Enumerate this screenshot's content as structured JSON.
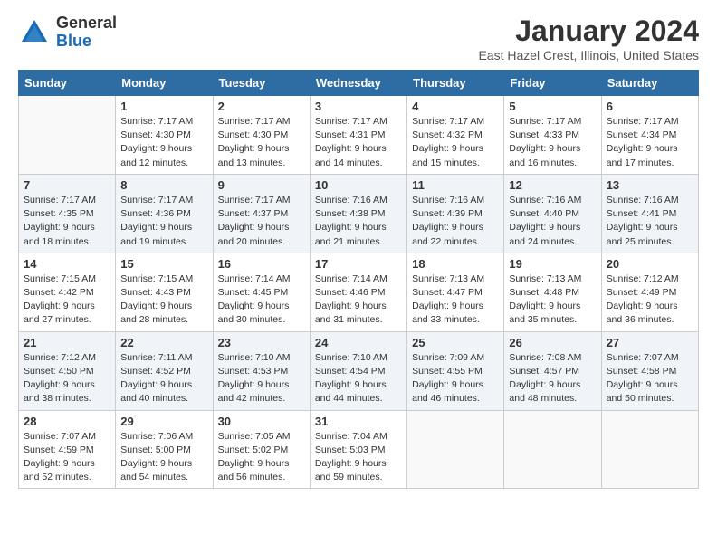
{
  "logo": {
    "general": "General",
    "blue": "Blue"
  },
  "title": "January 2024",
  "subtitle": "East Hazel Crest, Illinois, United States",
  "headers": [
    "Sunday",
    "Monday",
    "Tuesday",
    "Wednesday",
    "Thursday",
    "Friday",
    "Saturday"
  ],
  "weeks": [
    [
      {
        "day": "",
        "info": ""
      },
      {
        "day": "1",
        "info": "Sunrise: 7:17 AM\nSunset: 4:30 PM\nDaylight: 9 hours\nand 12 minutes."
      },
      {
        "day": "2",
        "info": "Sunrise: 7:17 AM\nSunset: 4:30 PM\nDaylight: 9 hours\nand 13 minutes."
      },
      {
        "day": "3",
        "info": "Sunrise: 7:17 AM\nSunset: 4:31 PM\nDaylight: 9 hours\nand 14 minutes."
      },
      {
        "day": "4",
        "info": "Sunrise: 7:17 AM\nSunset: 4:32 PM\nDaylight: 9 hours\nand 15 minutes."
      },
      {
        "day": "5",
        "info": "Sunrise: 7:17 AM\nSunset: 4:33 PM\nDaylight: 9 hours\nand 16 minutes."
      },
      {
        "day": "6",
        "info": "Sunrise: 7:17 AM\nSunset: 4:34 PM\nDaylight: 9 hours\nand 17 minutes."
      }
    ],
    [
      {
        "day": "7",
        "info": "Sunrise: 7:17 AM\nSunset: 4:35 PM\nDaylight: 9 hours\nand 18 minutes."
      },
      {
        "day": "8",
        "info": "Sunrise: 7:17 AM\nSunset: 4:36 PM\nDaylight: 9 hours\nand 19 minutes."
      },
      {
        "day": "9",
        "info": "Sunrise: 7:17 AM\nSunset: 4:37 PM\nDaylight: 9 hours\nand 20 minutes."
      },
      {
        "day": "10",
        "info": "Sunrise: 7:16 AM\nSunset: 4:38 PM\nDaylight: 9 hours\nand 21 minutes."
      },
      {
        "day": "11",
        "info": "Sunrise: 7:16 AM\nSunset: 4:39 PM\nDaylight: 9 hours\nand 22 minutes."
      },
      {
        "day": "12",
        "info": "Sunrise: 7:16 AM\nSunset: 4:40 PM\nDaylight: 9 hours\nand 24 minutes."
      },
      {
        "day": "13",
        "info": "Sunrise: 7:16 AM\nSunset: 4:41 PM\nDaylight: 9 hours\nand 25 minutes."
      }
    ],
    [
      {
        "day": "14",
        "info": "Sunrise: 7:15 AM\nSunset: 4:42 PM\nDaylight: 9 hours\nand 27 minutes."
      },
      {
        "day": "15",
        "info": "Sunrise: 7:15 AM\nSunset: 4:43 PM\nDaylight: 9 hours\nand 28 minutes."
      },
      {
        "day": "16",
        "info": "Sunrise: 7:14 AM\nSunset: 4:45 PM\nDaylight: 9 hours\nand 30 minutes."
      },
      {
        "day": "17",
        "info": "Sunrise: 7:14 AM\nSunset: 4:46 PM\nDaylight: 9 hours\nand 31 minutes."
      },
      {
        "day": "18",
        "info": "Sunrise: 7:13 AM\nSunset: 4:47 PM\nDaylight: 9 hours\nand 33 minutes."
      },
      {
        "day": "19",
        "info": "Sunrise: 7:13 AM\nSunset: 4:48 PM\nDaylight: 9 hours\nand 35 minutes."
      },
      {
        "day": "20",
        "info": "Sunrise: 7:12 AM\nSunset: 4:49 PM\nDaylight: 9 hours\nand 36 minutes."
      }
    ],
    [
      {
        "day": "21",
        "info": "Sunrise: 7:12 AM\nSunset: 4:50 PM\nDaylight: 9 hours\nand 38 minutes."
      },
      {
        "day": "22",
        "info": "Sunrise: 7:11 AM\nSunset: 4:52 PM\nDaylight: 9 hours\nand 40 minutes."
      },
      {
        "day": "23",
        "info": "Sunrise: 7:10 AM\nSunset: 4:53 PM\nDaylight: 9 hours\nand 42 minutes."
      },
      {
        "day": "24",
        "info": "Sunrise: 7:10 AM\nSunset: 4:54 PM\nDaylight: 9 hours\nand 44 minutes."
      },
      {
        "day": "25",
        "info": "Sunrise: 7:09 AM\nSunset: 4:55 PM\nDaylight: 9 hours\nand 46 minutes."
      },
      {
        "day": "26",
        "info": "Sunrise: 7:08 AM\nSunset: 4:57 PM\nDaylight: 9 hours\nand 48 minutes."
      },
      {
        "day": "27",
        "info": "Sunrise: 7:07 AM\nSunset: 4:58 PM\nDaylight: 9 hours\nand 50 minutes."
      }
    ],
    [
      {
        "day": "28",
        "info": "Sunrise: 7:07 AM\nSunset: 4:59 PM\nDaylight: 9 hours\nand 52 minutes."
      },
      {
        "day": "29",
        "info": "Sunrise: 7:06 AM\nSunset: 5:00 PM\nDaylight: 9 hours\nand 54 minutes."
      },
      {
        "day": "30",
        "info": "Sunrise: 7:05 AM\nSunset: 5:02 PM\nDaylight: 9 hours\nand 56 minutes."
      },
      {
        "day": "31",
        "info": "Sunrise: 7:04 AM\nSunset: 5:03 PM\nDaylight: 9 hours\nand 59 minutes."
      },
      {
        "day": "",
        "info": ""
      },
      {
        "day": "",
        "info": ""
      },
      {
        "day": "",
        "info": ""
      }
    ]
  ]
}
